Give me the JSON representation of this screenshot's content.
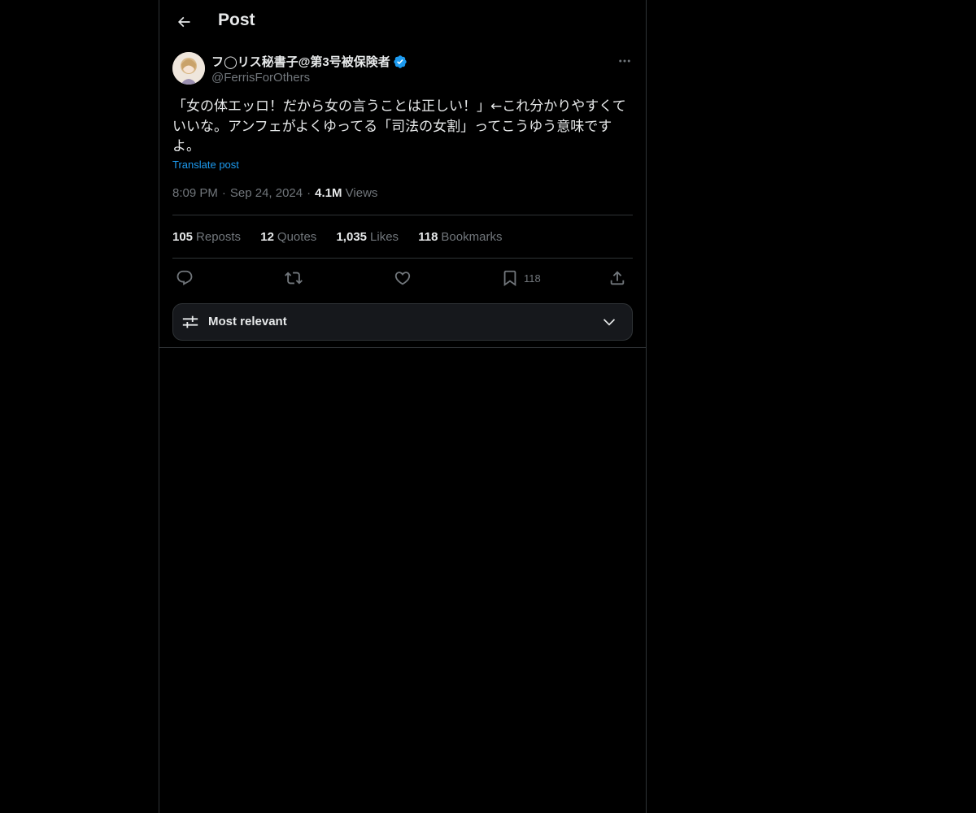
{
  "header": {
    "back_icon": "arrow-left-icon",
    "title": "Post"
  },
  "post": {
    "author": {
      "display_name": "フ◯リス秘書子@第3号被保険者",
      "verified_icon": "verified-badge-icon",
      "handle": "@FerrisForOthers"
    },
    "more_icon": "more-horizontal-icon",
    "text": "「女の体エッロ！だから女の言うことは正しい！」←これ分かりやすくていいな。アンフェがよくゆってる「司法の女割」ってこうゆう意味ですよ。",
    "translate_label": "Translate post",
    "time": "8:09 PM",
    "date": "Sep 24, 2024",
    "separator": "·",
    "views_count": "4.1M",
    "views_label": "Views"
  },
  "stats": [
    {
      "count": "105",
      "label": "Reposts"
    },
    {
      "count": "12",
      "label": "Quotes"
    },
    {
      "count": "1,035",
      "label": "Likes"
    },
    {
      "count": "118",
      "label": "Bookmarks"
    }
  ],
  "actions": {
    "reply_icon": "reply-icon",
    "repost_icon": "repost-icon",
    "like_icon": "heart-icon",
    "bookmark_icon": "bookmark-icon",
    "bookmark_count": "118",
    "share_icon": "share-icon"
  },
  "replies_filter": {
    "icon": "sliders-icon",
    "label": "Most relevant",
    "chevron_icon": "chevron-down-icon"
  },
  "colors": {
    "background": "#000000",
    "text_primary": "#e7e9ea",
    "text_secondary": "#71767b",
    "accent": "#1d9bf0",
    "border": "#2f3336"
  }
}
